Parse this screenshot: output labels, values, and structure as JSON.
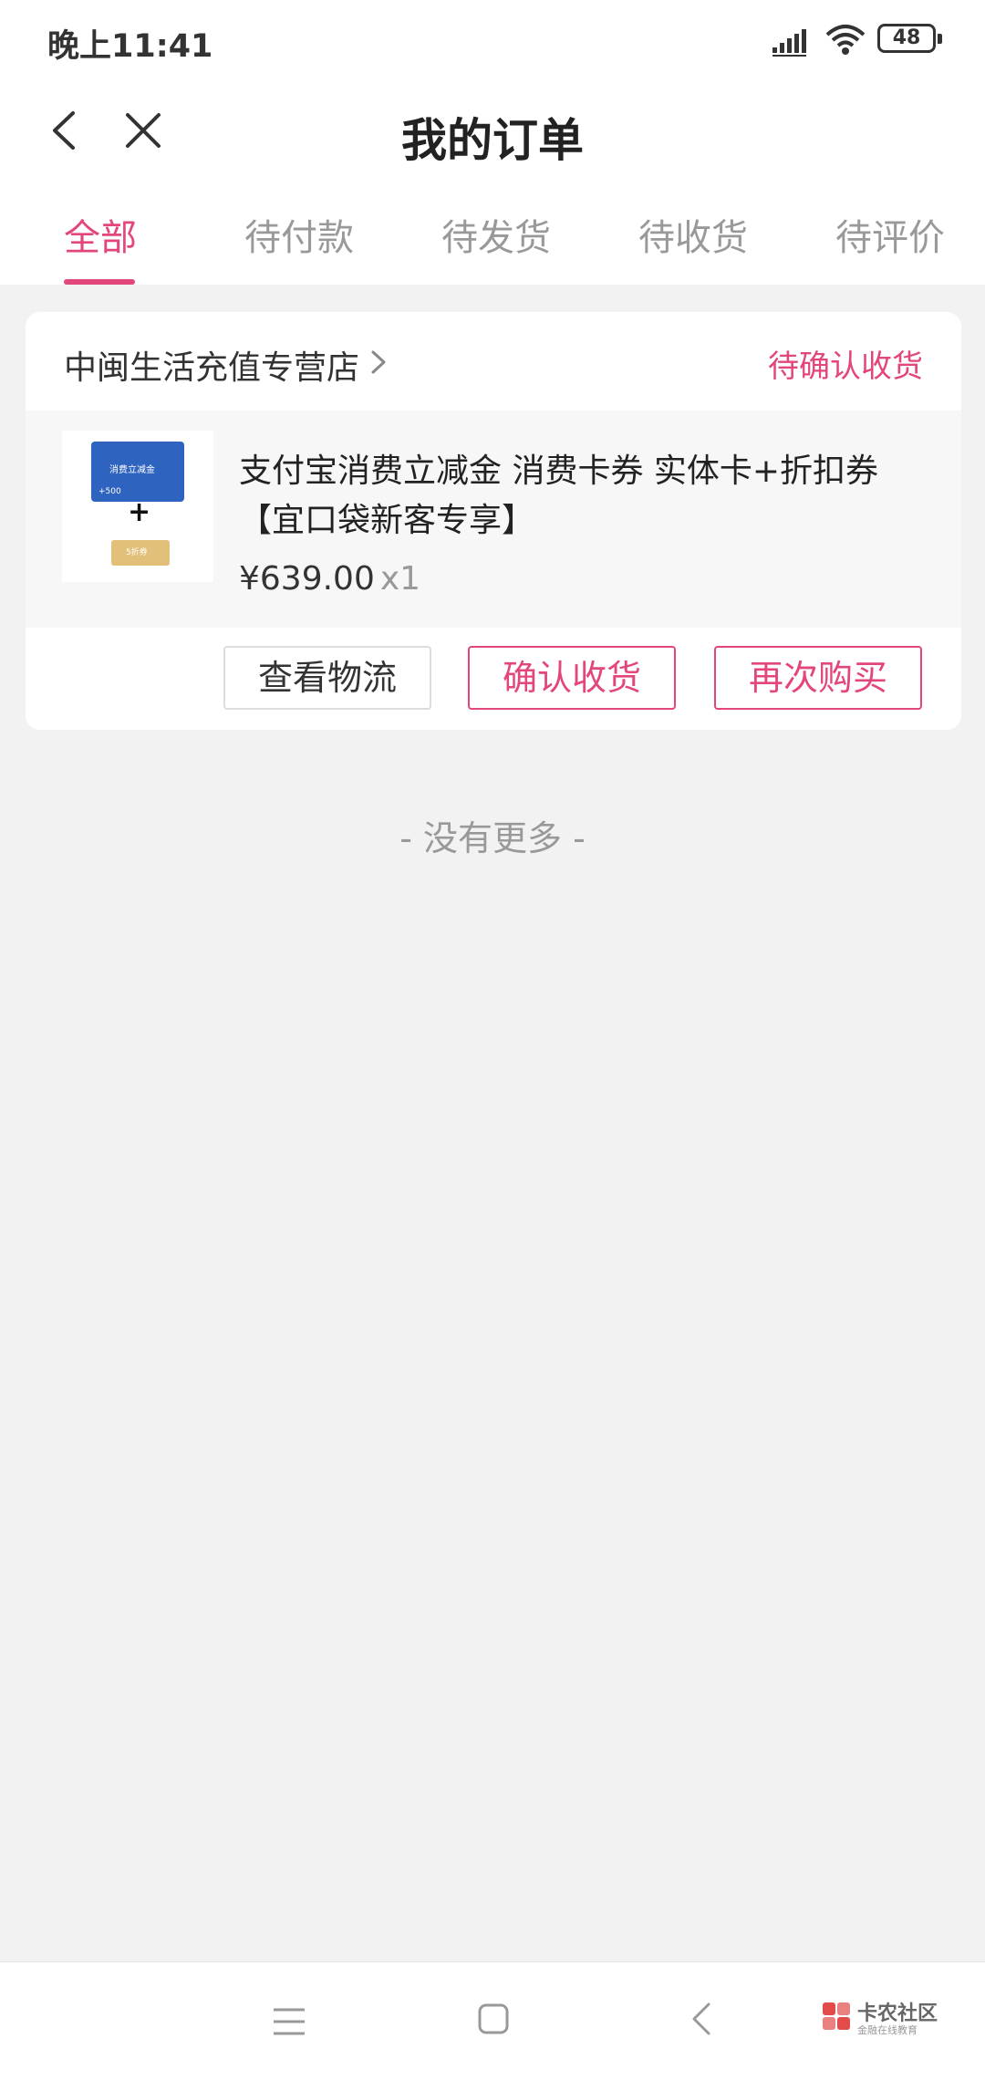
{
  "status_bar": {
    "time": "晚上11:41",
    "battery": "48",
    "signal_icon": "signal-icon",
    "wifi_icon": "wifi-icon"
  },
  "nav": {
    "title": "我的订单",
    "back_icon": "back-icon",
    "close_icon": "close-icon"
  },
  "tabs": [
    {
      "label": "全部",
      "active": true
    },
    {
      "label": "待付款",
      "active": false
    },
    {
      "label": "待发货",
      "active": false
    },
    {
      "label": "待收货",
      "active": false
    },
    {
      "label": "待评价",
      "active": false
    }
  ],
  "order": {
    "shop_name": "中闽生活充值专营店",
    "status": "待确认收货",
    "product": {
      "title": "支付宝消费立减金 消费卡券 实体卡+折扣券【宜口袋新客专享】",
      "price": "¥639.00",
      "quantity": "x1",
      "thumb_card_text": "消费立减金",
      "thumb_card_value": "+500",
      "thumb_coupon_text": "5折券"
    },
    "actions": {
      "logistics": "查看物流",
      "confirm": "确认收货",
      "rebuy": "再次购买"
    }
  },
  "footer_text": "- 没有更多 -",
  "watermark": {
    "title": "卡农社区",
    "subtitle": "金融在线教育"
  },
  "colors": {
    "accent": "#e3467a",
    "background": "#f2f2f2"
  }
}
